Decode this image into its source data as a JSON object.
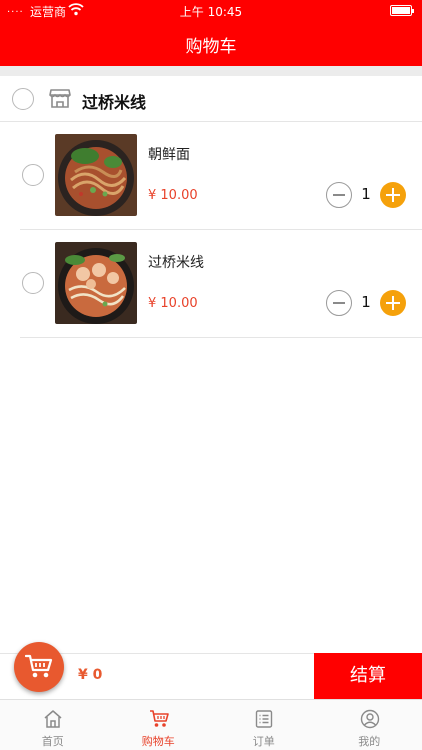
{
  "status_bar": {
    "signal": "....",
    "carrier": "运营商",
    "time": "上午 10:45"
  },
  "header": {
    "title": "购物车"
  },
  "shop": {
    "name": "过桥米线"
  },
  "items": [
    {
      "name": "朝鲜面",
      "price": "¥ 10.00",
      "quantity": "1"
    },
    {
      "name": "过桥米线",
      "price": "¥ 10.00",
      "quantity": "1"
    }
  ],
  "checkout": {
    "total": "¥ 0",
    "settle_label": "结算"
  },
  "tabs": [
    {
      "label": "首页",
      "icon": "home-icon"
    },
    {
      "label": "购物车",
      "icon": "cart-icon"
    },
    {
      "label": "订单",
      "icon": "list-icon"
    },
    {
      "label": "我的",
      "icon": "user-icon"
    }
  ],
  "colors": {
    "brand": "#ff0000",
    "accent": "#f5a10b",
    "price": "#e8422a",
    "cart_fab": "#e8592f"
  }
}
